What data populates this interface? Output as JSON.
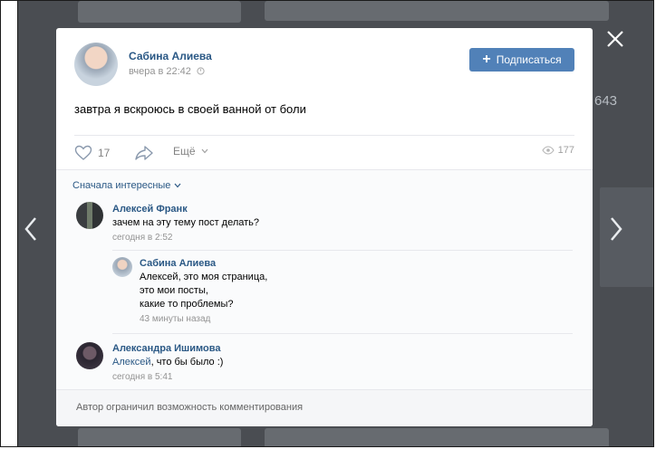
{
  "post": {
    "author": "Сабина Алиева",
    "time": "вчера в 22:42",
    "subscribe_label": "Подписаться",
    "text": "завтра я вскроюсь в своей ванной от боли",
    "likes": "17",
    "more_label": "Ещё",
    "views": "177"
  },
  "comments": {
    "sort_label": "Сначала интересные",
    "items": [
      {
        "author": "Алексей Франк",
        "text": "зачем на эту тему пост делать?",
        "time": "сегодня в 2:52"
      },
      {
        "author": "Сабина Алиева",
        "text_lines": [
          "Алексей, это моя страница,",
          "это мои посты,",
          "какие то проблемы?"
        ],
        "time": "43 минуты назад"
      },
      {
        "author": "Александра Ишимова",
        "mention": "Алексей",
        "text": ", что бы было :)",
        "time": "сегодня в 5:41"
      }
    ],
    "closed_note": "Автор ограничил возможность комментирования"
  },
  "background": {
    "stat_number": "643"
  },
  "colors": {
    "link": "#2a5885",
    "button": "#5181b8",
    "muted": "#939393",
    "overlay": "#4a4d52"
  }
}
